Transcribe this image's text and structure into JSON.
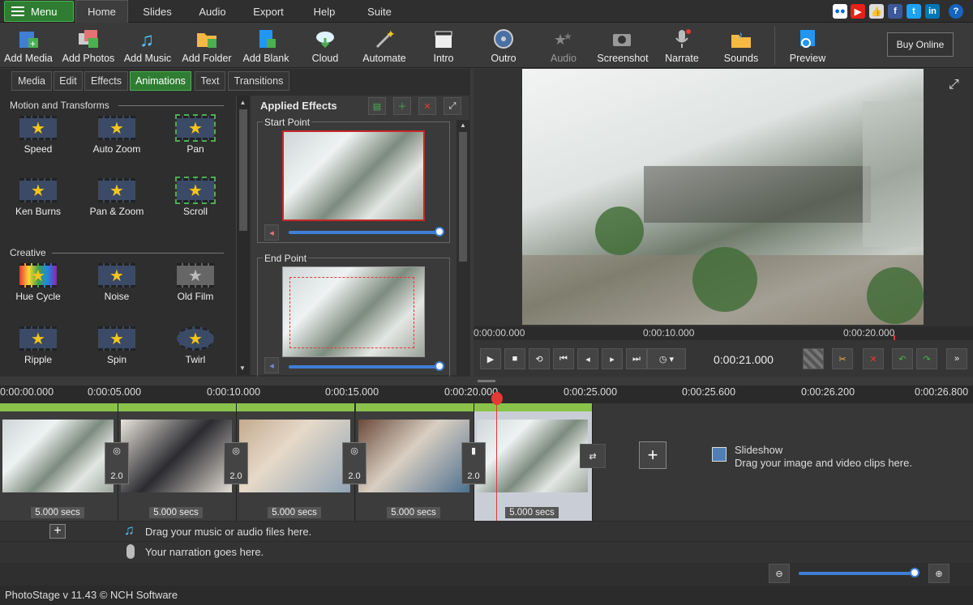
{
  "menubar": {
    "menu_label": "Menu",
    "tabs": [
      "Home",
      "Slides",
      "Audio",
      "Export",
      "Help",
      "Suite"
    ],
    "active_tab": "Home"
  },
  "toolbar": {
    "items": [
      {
        "label": "Add Media",
        "icon": "add-media-icon"
      },
      {
        "label": "Add Photos",
        "icon": "add-photos-icon"
      },
      {
        "label": "Add Music",
        "icon": "add-music-icon"
      },
      {
        "label": "Add Folder",
        "icon": "add-folder-icon"
      },
      {
        "label": "Add Blank",
        "icon": "add-blank-icon"
      },
      {
        "label": "Cloud",
        "icon": "cloud-icon"
      },
      {
        "label": "Automate",
        "icon": "magic-wand-icon"
      },
      {
        "label": "Intro",
        "icon": "clapperboard-icon"
      },
      {
        "label": "Outro",
        "icon": "film-reel-icon"
      },
      {
        "label": "Audio",
        "icon": "audio-stars-icon"
      },
      {
        "label": "Screenshot",
        "icon": "camera-icon"
      },
      {
        "label": "Narrate",
        "icon": "microphone-icon"
      },
      {
        "label": "Sounds",
        "icon": "sounds-folder-icon"
      },
      {
        "label": "Preview",
        "icon": "preview-icon"
      }
    ],
    "buy_label": "Buy Online"
  },
  "panel_tabs": [
    "Media",
    "Edit",
    "Effects",
    "Animations",
    "Text",
    "Transitions"
  ],
  "active_panel_tab": "Animations",
  "effects": {
    "motion_title": "Motion and Transforms",
    "motion_items": [
      "Speed",
      "Auto Zoom",
      "Pan",
      "Ken Burns",
      "Pan & Zoom",
      "Scroll"
    ],
    "creative_title": "Creative",
    "creative_items": [
      "Hue Cycle",
      "Noise",
      "Old Film",
      "Ripple",
      "Spin",
      "Twirl"
    ]
  },
  "applied": {
    "title": "Applied Effects",
    "start_label": "Start Point",
    "end_label": "End Point"
  },
  "preview": {
    "ruler_ticks": [
      "0:00:00.000",
      "0:00:10.000",
      "0:00:20.000"
    ],
    "time_display": "0:00:21.000"
  },
  "timeline": {
    "ruler_ticks": [
      "0:00:00.000",
      "0:00:05.000",
      "0:00:10.000",
      "0:00:15.000",
      "0:00:20.000",
      "0:00:25.000",
      "0:00:25.600",
      "0:00:26.200",
      "0:00:26.800"
    ],
    "clip_durations": [
      "5.000 secs",
      "5.000 secs",
      "5.000 secs",
      "5.000 secs",
      "5.000 secs"
    ],
    "transition_values": [
      "2.0",
      "2.0",
      "2.0",
      "2.0"
    ],
    "slideshow_title": "Slideshow",
    "slideshow_hint": "Drag your image and video clips here.",
    "audio_hint": "Drag your music or audio files here.",
    "narration_hint": "Your narration goes here."
  },
  "status": "PhotoStage v 11.43 © NCH Software"
}
